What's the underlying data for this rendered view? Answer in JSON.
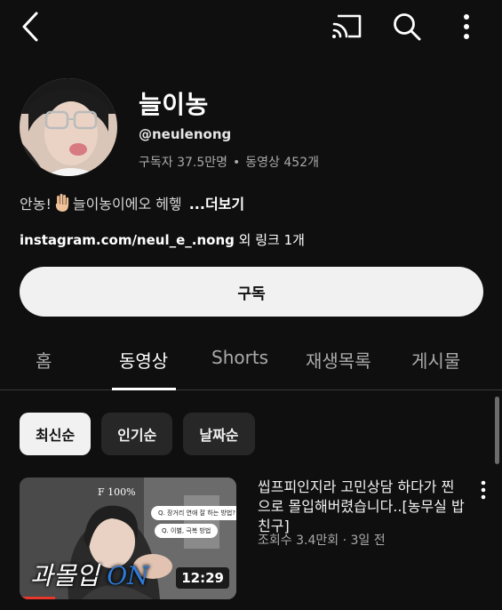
{
  "icons": {
    "back": "chevron-left-icon",
    "cast": "cast-icon",
    "search": "search-icon",
    "more": "more-vertical-icon",
    "video_menu": "more-vertical-icon"
  },
  "channel": {
    "name": "늘이농",
    "handle": "@neulenong",
    "subscribers": "구독자 37.5만명",
    "videos": "동영상 452개",
    "description_before": "안농!",
    "description_after": "늘이농이에오 헤헿",
    "more_label": "...더보기",
    "link_domain": "instagram.com/neul_e_.nong",
    "link_extra": " 외 링크 1개"
  },
  "subscribe_label": "구독",
  "tabs": [
    {
      "label": "홈"
    },
    {
      "label": "동영상"
    },
    {
      "label": "Shorts"
    },
    {
      "label": "재생목록"
    },
    {
      "label": "게시물"
    }
  ],
  "active_tab": "동영상",
  "chips": [
    {
      "label": "최신순"
    },
    {
      "label": "인기순"
    },
    {
      "label": "날짜순"
    }
  ],
  "active_chip": "최신순",
  "video": {
    "title": "씹프피인지라 고민상담 하다가 찐으로 몰입해버렸습니다..[농무실 밥친구]",
    "views": "조회수 3.4만회",
    "age": "3일 전",
    "duration": "12:29",
    "thumb_caption_main": "과몰입",
    "thumb_caption_on": "ON",
    "thumb_percent": "F 100%",
    "bubble1": "Q. 장거리 연애 잘 하는 방법?",
    "bubble2": "Q. 이별, 극복 방법"
  },
  "colors": {
    "background": "#0f0f0f",
    "subscribe_bg": "#f1f1f1",
    "chip_bg": "#272727",
    "secondary_text": "#aaaaaa",
    "caption_on": "#2d7ad8"
  }
}
